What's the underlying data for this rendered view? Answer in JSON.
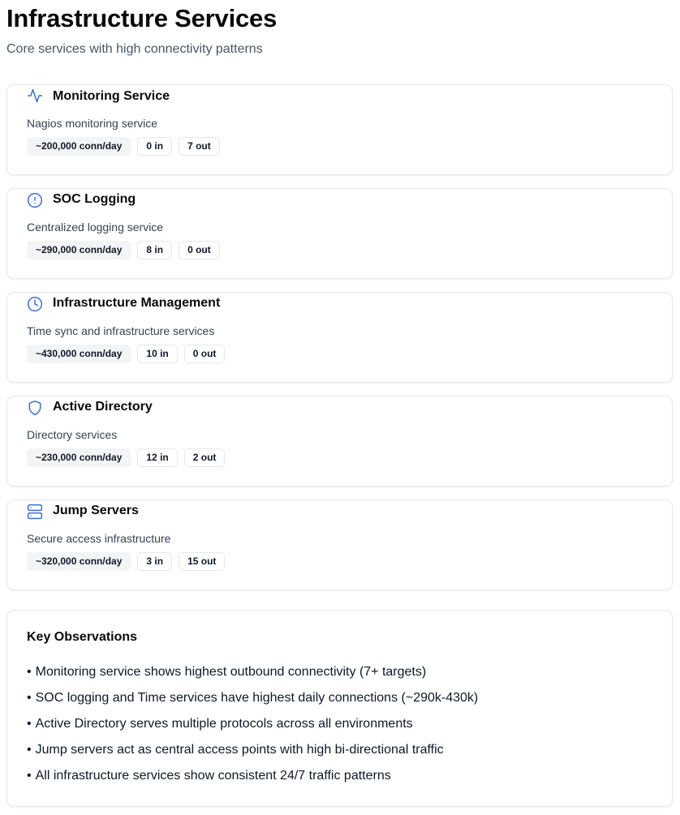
{
  "header": {
    "title": "Infrastructure Services",
    "subtitle": "Core services with high connectivity patterns"
  },
  "accent_color": "#3b6fd8",
  "services": [
    {
      "icon": "activity-icon",
      "name": "Monitoring Service",
      "description": "Nagios monitoring service",
      "connections": "~200,000 conn/day",
      "inbound": "0 in",
      "outbound": "7 out"
    },
    {
      "icon": "alert-circle-icon",
      "name": "SOC Logging",
      "description": "Centralized logging service",
      "connections": "~290,000 conn/day",
      "inbound": "8 in",
      "outbound": "0 out"
    },
    {
      "icon": "clock-icon",
      "name": "Infrastructure Management",
      "description": "Time sync and infrastructure services",
      "connections": "~430,000 conn/day",
      "inbound": "10 in",
      "outbound": "0 out"
    },
    {
      "icon": "shield-icon",
      "name": "Active Directory",
      "description": "Directory services",
      "connections": "~230,000 conn/day",
      "inbound": "12 in",
      "outbound": "2 out"
    },
    {
      "icon": "server-icon",
      "name": "Jump Servers",
      "description": "Secure access infrastructure",
      "connections": "~320,000 conn/day",
      "inbound": "3 in",
      "outbound": "15 out"
    }
  ],
  "observations": {
    "title": "Key Observations",
    "bullet": "•",
    "items": [
      "Monitoring service shows highest outbound connectivity (7+ targets)",
      "SOC logging and Time services have highest daily connections (~290k-430k)",
      "Active Directory serves multiple protocols across all environments",
      "Jump servers act as central access points with high bi-directional traffic",
      "All infrastructure services show consistent 24/7 traffic patterns"
    ]
  }
}
